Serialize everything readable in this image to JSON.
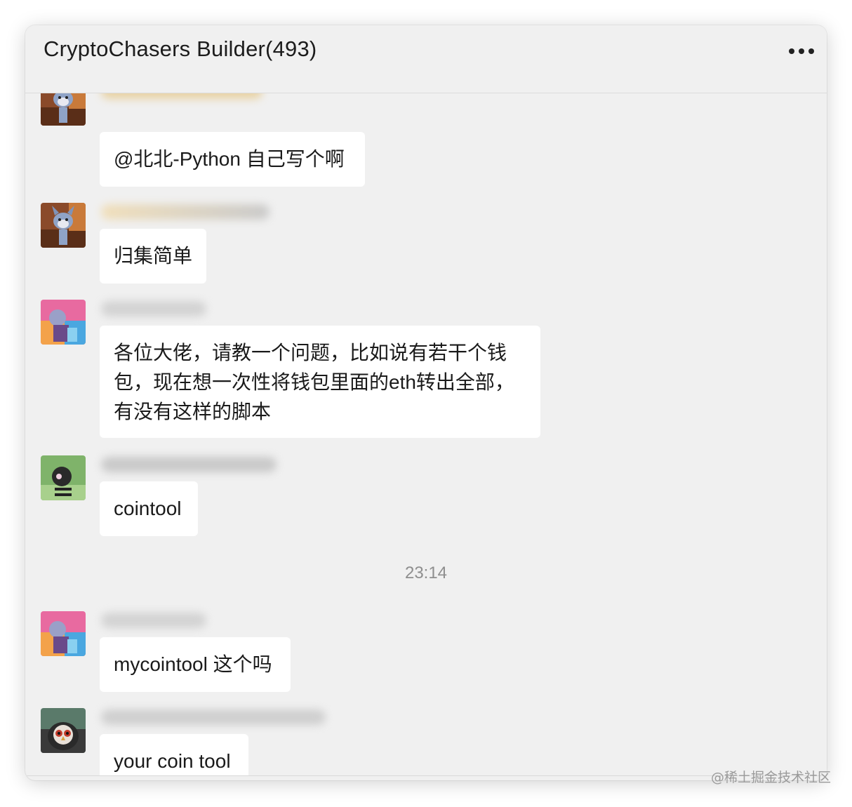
{
  "window": {
    "title": "CryptoChasers Builder(493)"
  },
  "messages": [
    {
      "avatar_icon": "tom-cat-avatar-icon",
      "text": "@北北-Python 自己写个啊"
    },
    {
      "avatar_icon": "tom-cat-avatar-icon",
      "text": "归集简单"
    },
    {
      "avatar_icon": "anime-avatar-icon",
      "text": "各位大佬，请教一个问题，比如说有若干个钱包，现在想一次性将钱包里面的eth转出全部，有没有这样的脚本"
    },
    {
      "avatar_icon": "cartoon-avatar-icon",
      "text": "cointool"
    },
    {
      "avatar_icon": "anime-avatar-icon",
      "text": "mycointool 这个吗"
    },
    {
      "avatar_icon": "owl-avatar-icon",
      "text": "your coin tool"
    }
  ],
  "timestamp": "23:14",
  "watermark": "@稀土掘金技术社区",
  "colors": {
    "window_bg": "#f0f0f0",
    "bubble_bg": "#ffffff",
    "timestamp": "#8e8e8e"
  }
}
